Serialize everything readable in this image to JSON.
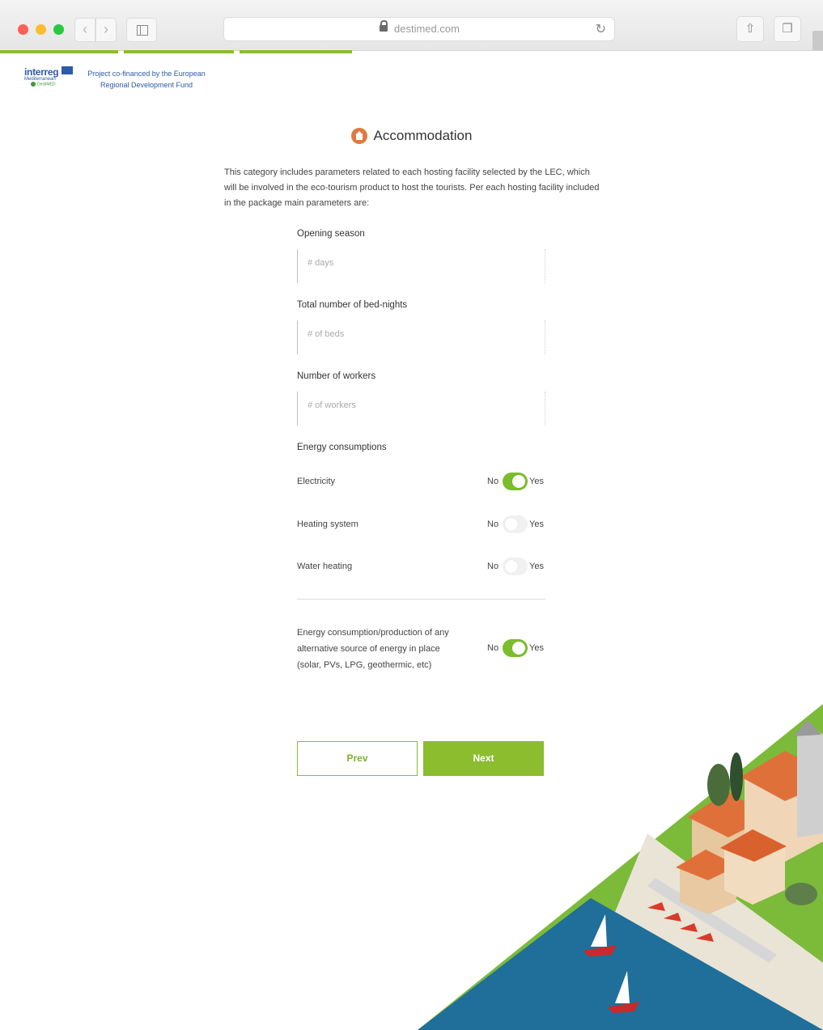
{
  "browser": {
    "url": "destimed.com",
    "progress_segments": 3
  },
  "branding": {
    "logo_word": "interreg",
    "logo_sub": "Mediterranean",
    "logo_project": "DestiMED",
    "funding_line1": "Project co-financed by the European",
    "funding_line2": "Regional Development Fund"
  },
  "page": {
    "title": "Accommodation",
    "intro": "This category includes parameters related to each hosting facility selected by the LEC, which will be involved in the eco-tourism product to host the tourists. Per each hosting facility included in the package main parameters are:"
  },
  "form": {
    "opening_season": {
      "label": "Opening season",
      "placeholder": "# days",
      "value": ""
    },
    "bed_nights": {
      "label": "Total number of bed-nights",
      "placeholder": "# of beds",
      "value": ""
    },
    "workers": {
      "label": "Number of workers",
      "placeholder": "# of workers",
      "value": ""
    },
    "energy_heading": "Energy consumptions",
    "toggles": [
      {
        "label": "Electricity",
        "no": "No",
        "yes": "Yes",
        "on": true
      },
      {
        "label": "Heating system",
        "no": "No",
        "yes": "Yes",
        "on": false
      },
      {
        "label": "Water heating",
        "no": "No",
        "yes": "Yes",
        "on": false
      }
    ],
    "alternative": {
      "label": "Energy consumption/production of any alternative source of energy in place (solar, PVs, LPG, geothermic, etc)",
      "no": "No",
      "yes": "Yes",
      "on": true
    },
    "prev_label": "Prev",
    "next_label": "Next"
  },
  "colors": {
    "accent_green": "#8bbd2f",
    "title_icon": "#e07840",
    "brand_blue": "#2e5aa7"
  }
}
